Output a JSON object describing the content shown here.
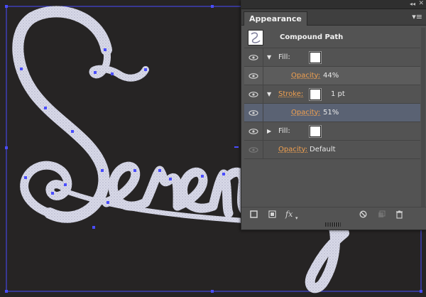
{
  "panel": {
    "title": "Appearance",
    "collapse_icon": "◂◂",
    "close_icon": "✕",
    "menu_icon": "▾≡",
    "header_title": "Compound Path",
    "rows": [
      {
        "label": "Fill:",
        "expanded": true
      },
      {
        "label": "Opacity:",
        "value": "44%"
      },
      {
        "label": "Stroke:",
        "expanded": true,
        "stroke_weight": "1 pt"
      },
      {
        "label": "Opacity:",
        "value": "51%"
      },
      {
        "label": "Fill:",
        "expanded": false
      },
      {
        "label": "Opacity:",
        "value": "Default"
      }
    ],
    "footer": {
      "new_stroke_icon": "square-outline-icon",
      "new_fill_icon": "square-fill-icon",
      "fx_label": "fx",
      "clear_icon": "no-entry-icon",
      "duplicate_icon": "duplicate-icon",
      "delete_icon": "trash-icon"
    }
  },
  "colors": {
    "canvas_bg": "#262424",
    "panel_bg": "#535353",
    "accent_link": "#f0a050",
    "selection_row": "#5a6273",
    "artwork_guide": "#4a4dff"
  }
}
